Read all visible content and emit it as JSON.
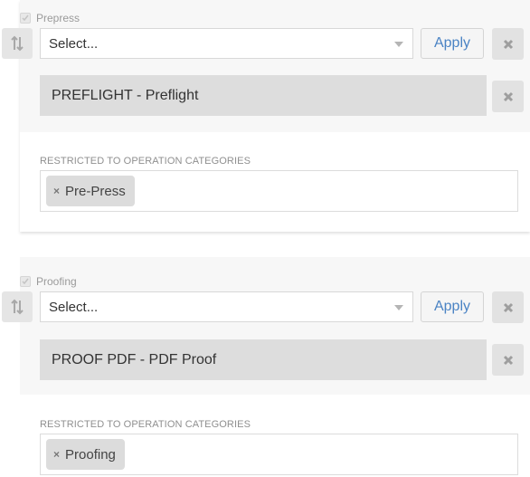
{
  "sections": [
    {
      "checkbox_label": "Prepress",
      "select_placeholder": "Select...",
      "apply_label": "Apply",
      "operation": "PREFLIGHT - Preflight",
      "restricted_label": "RESTRICTED TO OPERATION CATEGORIES",
      "tags": [
        "Pre-Press"
      ]
    },
    {
      "checkbox_label": "Proofing",
      "select_placeholder": "Select...",
      "apply_label": "Apply",
      "operation": "PROOF PDF - PDF Proof",
      "restricted_label": "RESTRICTED TO OPERATION CATEGORIES",
      "tags": [
        "Proofing"
      ]
    }
  ],
  "icons": {
    "sort": "sort-updown-icon",
    "remove": "remove-x-icon",
    "tag_remove": "tag-remove-icon",
    "checkbox": "checkbox-icon"
  },
  "colors": {
    "apply_text": "#4a83c4",
    "panel_bg": "#f7f7f7",
    "operation_bar": "#dddddd"
  }
}
